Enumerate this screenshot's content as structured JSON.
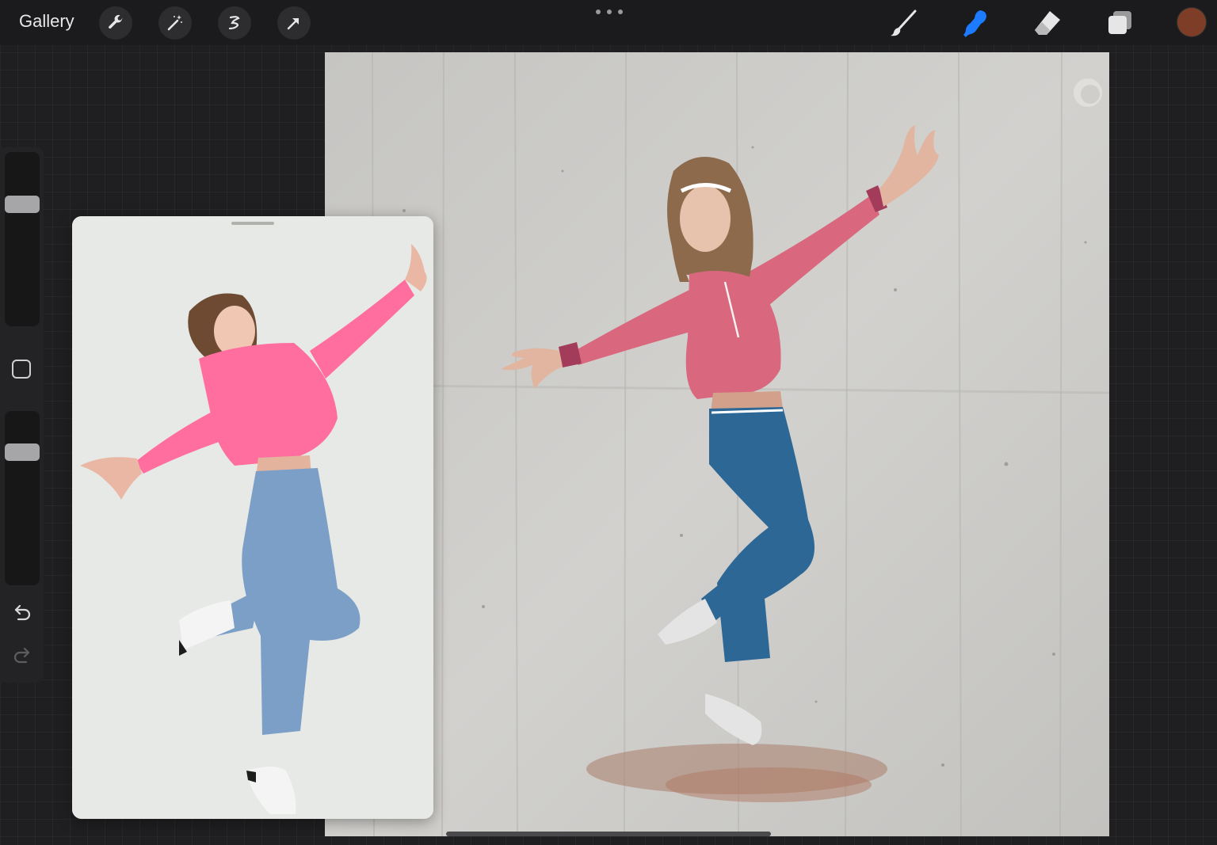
{
  "topbar": {
    "gallery_label": "Gallery",
    "left_tools": [
      "wrench-icon",
      "magic-wand-icon",
      "selection-icon",
      "transform-arrow-icon"
    ],
    "right_tools": [
      "brush-icon",
      "smudge-icon",
      "eraser-icon",
      "layers-icon"
    ],
    "active_tool": "smudge",
    "current_color": "#7e3d26"
  },
  "sidebar": {
    "brush_size_level": 0.7,
    "opacity_level": 0.75
  },
  "colors": {
    "accent_blue": "#1d7bff",
    "sweater_pink": "#d9687f",
    "jeans_blue": "#2c6796",
    "canvas_concrete": "#cbcac7"
  }
}
